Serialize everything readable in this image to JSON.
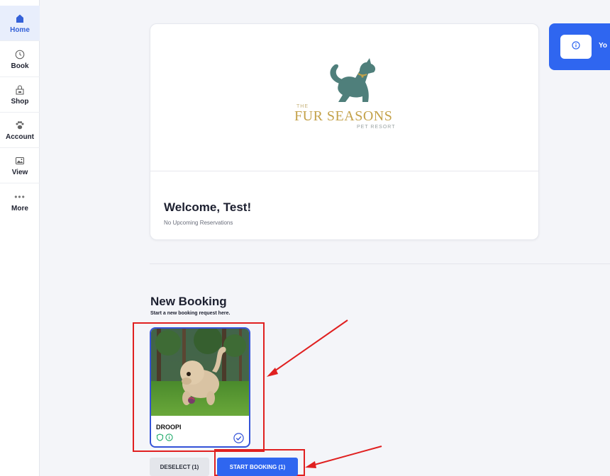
{
  "sidebar": {
    "items": [
      {
        "label": "Home",
        "icon": "home-icon",
        "active": true
      },
      {
        "label": "Book",
        "icon": "clock-icon"
      },
      {
        "label": "Shop",
        "icon": "shop-icon"
      },
      {
        "label": "Account",
        "icon": "paw-icon"
      },
      {
        "label": "View",
        "icon": "image-icon"
      },
      {
        "label": "More",
        "icon": "more-icon"
      }
    ]
  },
  "brand": {
    "logo_the": "THE",
    "logo_main": "FUR SEASONS",
    "logo_sub": "PET RESORT",
    "colors": {
      "dog": "#4f7f7b",
      "gold": "#c4a24a"
    }
  },
  "welcome": {
    "title": "Welcome, Test!",
    "subtitle": "No Upcoming Reservations"
  },
  "banner": {
    "text": "Yo",
    "color": "#2f66f0"
  },
  "new_booking": {
    "title": "New Booking",
    "subtitle": "Start a new booking request here.",
    "pets": [
      {
        "name": "DROOPI",
        "selected": true
      }
    ],
    "deselect_label": "DESELECT (1)",
    "start_label": "START BOOKING (1)"
  },
  "colors": {
    "accent": "#2f66f0",
    "selection_border": "#3453d8",
    "annotation": "#e02020"
  }
}
